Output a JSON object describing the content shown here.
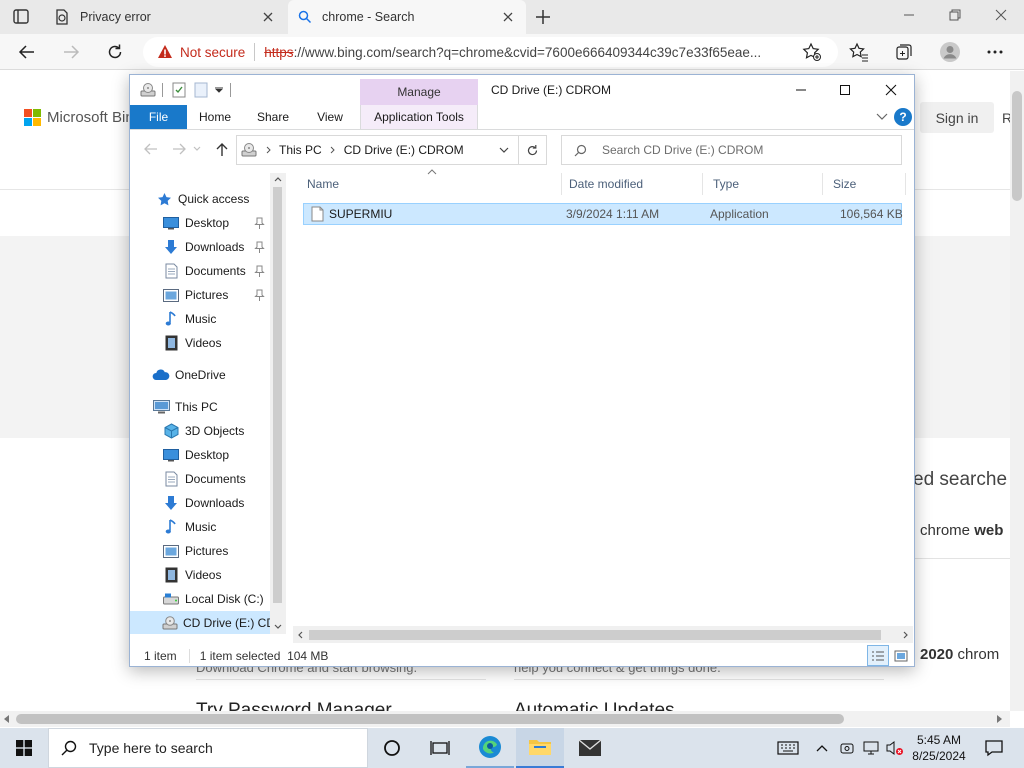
{
  "browser": {
    "tabs": [
      {
        "title": "Privacy error"
      },
      {
        "title": "chrome - Search"
      }
    ],
    "address": {
      "not_secure": "Not secure",
      "scheme": "https",
      "rest": "://www.bing.com/search?q=chrome&cvid=7600e666409344c39c7e33f65eae..."
    }
  },
  "bing": {
    "logo_text": "Microsoft Bin",
    "sign_in": "Sign in",
    "sign_in_cut": "R",
    "related_searches": "ed searche",
    "chrome_web_prefix": "chrome ",
    "chrome_web_bold": "web",
    "year_bold": "2020",
    "year_suffix": " chrom",
    "left_sub": "Download Chrome and start browsing.",
    "mid_sub": "help you connect & get things done.",
    "left_heading": "Try Password Manager",
    "mid_heading": "Automatic Updates"
  },
  "explorer": {
    "title": "CD Drive (E:) CDROM",
    "manage_tab": "Manage",
    "ribbon_tabs": {
      "file": "File",
      "home": "Home",
      "share": "Share",
      "view": "View",
      "app_tools": "Application Tools"
    },
    "breadcrumb": {
      "root": "This PC",
      "current": "CD Drive (E:) CDROM"
    },
    "search_placeholder": "Search CD Drive (E:) CDROM",
    "nav": {
      "quick_access": "Quick access",
      "qa_desktop": "Desktop",
      "qa_downloads": "Downloads",
      "qa_documents": "Documents",
      "qa_pictures": "Pictures",
      "qa_music": "Music",
      "qa_videos": "Videos",
      "onedrive": "OneDrive",
      "this_pc": "This PC",
      "pc_3d": "3D Objects",
      "pc_desktop": "Desktop",
      "pc_documents": "Documents",
      "pc_downloads": "Downloads",
      "pc_music": "Music",
      "pc_pictures": "Pictures",
      "pc_videos": "Videos",
      "local_disk": "Local Disk (C:)",
      "cd_drive": "CD Drive (E:) CD"
    },
    "columns": {
      "name": "Name",
      "date": "Date modified",
      "type": "Type",
      "size": "Size"
    },
    "file": {
      "name": "SUPERMIU",
      "date": "3/9/2024 1:11 AM",
      "type": "Application",
      "size": "106,564 KB"
    },
    "status": {
      "count": "1 item",
      "selected": "1 item selected  104 MB"
    }
  },
  "taskbar": {
    "search_placeholder": "Type here to search",
    "time": "5:45 AM",
    "date": "8/25/2024"
  },
  "colors": {
    "accent": "#1979ca",
    "selection": "#cce8ff",
    "manage_tab": "#e7d2f1",
    "not_secure": "#c42b1c"
  }
}
